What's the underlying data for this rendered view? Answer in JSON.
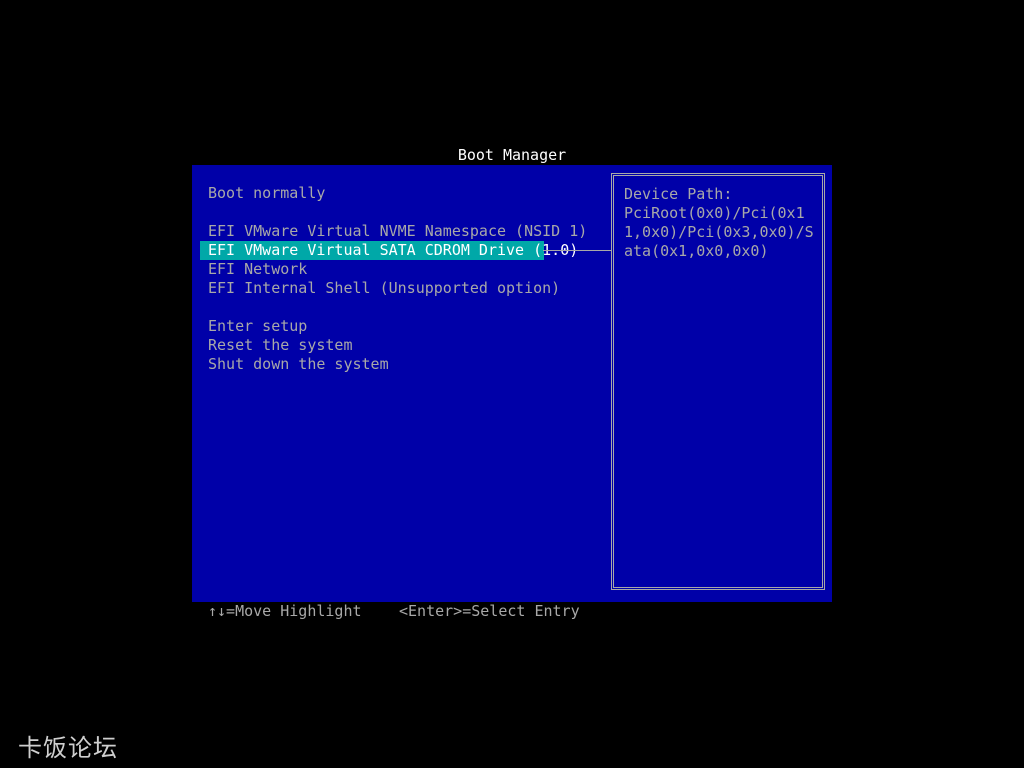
{
  "title": "Boot Manager",
  "menu": {
    "boot_normally": "Boot normally",
    "devices": [
      "EFI VMware Virtual NVME Namespace (NSID 1)",
      "EFI VMware Virtual SATA CDROM Drive (1.0)",
      "EFI Network",
      "EFI Internal Shell (Unsupported option)"
    ],
    "selected_index": 1,
    "actions": [
      "Enter setup",
      "Reset the system",
      "Shut down the system"
    ]
  },
  "help": {
    "heading": "Device Path:",
    "path": "PciRoot(0x0)/Pci(0x11,0x0)/Pci(0x3,0x0)/Sata(0x1,0x0,0x0)"
  },
  "footer": {
    "nav_hint": "↑↓=Move Highlight",
    "select_hint": "<Enter>=Select Entry"
  },
  "watermark": "卡饭论坛",
  "colors": {
    "background": "#000000",
    "panel": "#0000a8",
    "text": "#a8a8a8",
    "highlight": "#00a8a8",
    "highlight_text": "#ffffff",
    "title": "#ffffff"
  }
}
